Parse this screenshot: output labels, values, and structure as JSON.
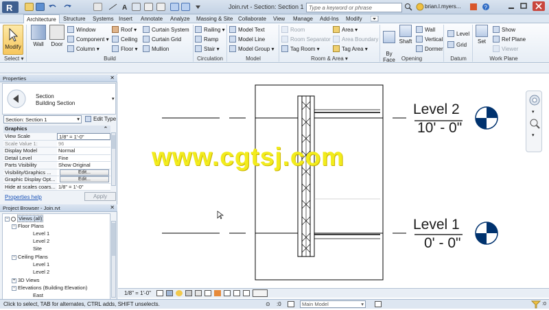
{
  "window": {
    "title": "Join.rvt - Section: Section 1",
    "search_placeholder": "Type a keyword or phrase",
    "user": "brian.l.myers..."
  },
  "tabs": [
    "Architecture",
    "Structure",
    "Systems",
    "Insert",
    "Annotate",
    "Analyze",
    "Massing & Site",
    "Collaborate",
    "View",
    "Manage",
    "Add-Ins",
    "Modify"
  ],
  "ribbon": {
    "select": {
      "modify": "Modify",
      "panel": "Select ▾"
    },
    "build": {
      "panel": "Build",
      "wall": "Wall",
      "door": "Door",
      "window": "Window",
      "component": "Component ▾",
      "column": "Column ▾",
      "roof": "Roof ▾",
      "ceiling": "Ceiling",
      "floor": "Floor ▾",
      "curtain_system": "Curtain System",
      "curtain_grid": "Curtain Grid",
      "mullion": "Mullion"
    },
    "circulation": {
      "panel": "Circulation",
      "railing": "Railing ▾",
      "ramp": "Ramp",
      "stair": "Stair ▾"
    },
    "model": {
      "panel": "Model",
      "model_text": "Model Text",
      "model_line": "Model Line",
      "model_group": "Model Group ▾"
    },
    "room_area": {
      "panel": "Room & Area ▾",
      "room": "Room",
      "room_separator": "Room Separator",
      "tag_room": "Tag Room ▾",
      "area": "Area ▾",
      "area_boundary": "Area Boundary",
      "tag_area": "Tag Area ▾"
    },
    "opening": {
      "panel": "Opening",
      "by_face": "By\nFace",
      "shaft": "Shaft",
      "wall": "Wall",
      "vertical": "Vertical",
      "dormer": "Dormer"
    },
    "datum": {
      "panel": "Datum",
      "level": "Level",
      "grid": "Grid"
    },
    "work_plane": {
      "panel": "Work Plane",
      "set": "Set",
      "show": "Show",
      "ref_plane": "Ref Plane",
      "viewer": "Viewer"
    }
  },
  "properties": {
    "title": "Properties",
    "type_name": "Section",
    "type_sub": "Building Section",
    "selector": "Section: Section 1",
    "edit_type": "Edit Type",
    "group": "Graphics",
    "rows": [
      {
        "name": "View Scale",
        "value": "1/8\" = 1'-0\""
      },
      {
        "name": "Scale Value    1:",
        "value": "96"
      },
      {
        "name": "Display Model",
        "value": "Normal"
      },
      {
        "name": "Detail Level",
        "value": "Fine"
      },
      {
        "name": "Parts Visibility",
        "value": "Show Original"
      },
      {
        "name": "Visibility/Graphics ...",
        "value": "Edit..."
      },
      {
        "name": "Graphic Display Opt...",
        "value": "Edit..."
      },
      {
        "name": "Hide at scales coars...",
        "value": "1/8\" = 1'-0\""
      }
    ],
    "help": "Properties help",
    "apply": "Apply"
  },
  "browser": {
    "title": "Project Browser - Join.rvt",
    "nodes": [
      {
        "label": "Views (all)",
        "depth": 0,
        "exp": "−"
      },
      {
        "label": "Floor Plans",
        "depth": 1,
        "exp": "−"
      },
      {
        "label": "Level 1",
        "depth": 2,
        "exp": ""
      },
      {
        "label": "Level 2",
        "depth": 2,
        "exp": ""
      },
      {
        "label": "Site",
        "depth": 2,
        "exp": ""
      },
      {
        "label": "Ceiling Plans",
        "depth": 1,
        "exp": "−"
      },
      {
        "label": "Level 1",
        "depth": 2,
        "exp": ""
      },
      {
        "label": "Level 2",
        "depth": 2,
        "exp": ""
      },
      {
        "label": "3D Views",
        "depth": 1,
        "exp": "+"
      },
      {
        "label": "Elevations (Building Elevation)",
        "depth": 1,
        "exp": "−"
      },
      {
        "label": "East",
        "depth": 2,
        "exp": ""
      }
    ]
  },
  "drawing": {
    "level2_name": "Level 2",
    "level2_elev": "10' - 0\"",
    "level1_name": "Level 1",
    "level1_elev": "0' - 0\""
  },
  "view_control": {
    "scale": "1/8\" = 1'-0\""
  },
  "status": {
    "text": "Click to select, TAB for alternates, CTRL adds, SHIFT unselects.",
    "model": "Main Model"
  },
  "watermark": "www.cgtsj.com"
}
